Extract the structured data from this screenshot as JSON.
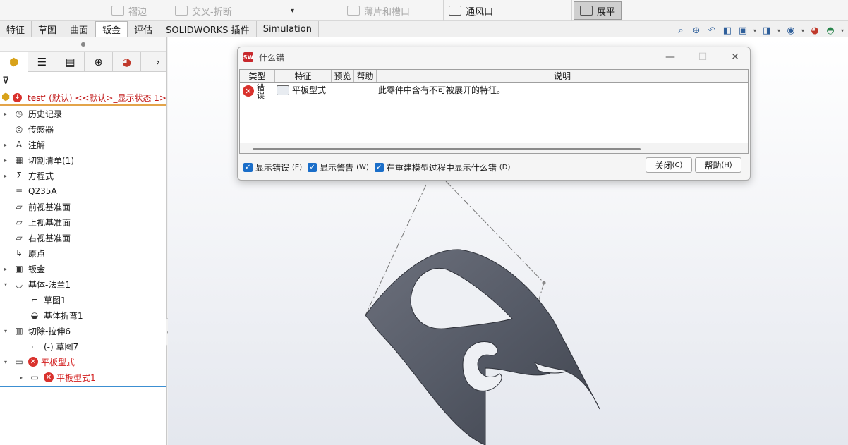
{
  "ribbon": {
    "items": [
      {
        "label": "褶边",
        "disabled": true
      },
      {
        "label": "交叉-折断",
        "disabled": true
      },
      {
        "label": "薄片和槽口",
        "disabled": true
      },
      {
        "label": "通风口",
        "disabled": false
      },
      {
        "label": "展平",
        "disabled": false,
        "active": true
      }
    ]
  },
  "tabs": [
    "特征",
    "草图",
    "曲面",
    "钣金",
    "评估",
    "SOLIDWORKS 插件",
    "Simulation"
  ],
  "active_tab": "钣金",
  "view_tools": [
    "zoom-to-fit-icon",
    "zoom-to-area-icon",
    "previous-view-icon",
    "section-view-icon",
    "view-orientation-icon",
    "display-style-icon",
    "hide-show-icon",
    "appearance-icon",
    "scene-icon"
  ],
  "panel": {
    "tabs": [
      "featuremanager-icon",
      "propertymanager-icon",
      "configurationmanager-icon",
      "dimxpert-icon",
      "display-manager-icon"
    ],
    "root": "test' (默认) <<默认>_显示状态 1>",
    "tree": [
      {
        "label": "历史记录",
        "expand": true,
        "indent": 0,
        "icon": "history-icon"
      },
      {
        "label": "传感器",
        "expand": false,
        "indent": 0,
        "icon": "sensor-icon"
      },
      {
        "label": "注解",
        "expand": true,
        "indent": 0,
        "icon": "annotation-icon"
      },
      {
        "label": "切割清单(1)",
        "expand": true,
        "indent": 0,
        "icon": "cut-list-icon"
      },
      {
        "label": "方程式",
        "expand": true,
        "indent": 0,
        "icon": "equation-icon"
      },
      {
        "label": "Q235A",
        "expand": false,
        "indent": 0,
        "icon": "material-icon"
      },
      {
        "label": "前视基准面",
        "expand": false,
        "indent": 0,
        "icon": "plane-icon"
      },
      {
        "label": "上视基准面",
        "expand": false,
        "indent": 0,
        "icon": "plane-icon"
      },
      {
        "label": "右视基准面",
        "expand": false,
        "indent": 0,
        "icon": "plane-icon"
      },
      {
        "label": "原点",
        "expand": false,
        "indent": 0,
        "icon": "origin-icon"
      },
      {
        "label": "钣金",
        "expand": true,
        "indent": 0,
        "icon": "sheet-metal-icon"
      },
      {
        "label": "基体-法兰1",
        "expand": true,
        "open": true,
        "indent": 0,
        "icon": "base-flange-icon"
      },
      {
        "label": "草图1",
        "expand": false,
        "indent": 1,
        "icon": "sketch-icon"
      },
      {
        "label": "基体折弯1",
        "expand": false,
        "indent": 1,
        "icon": "bend-icon"
      },
      {
        "label": "切除-拉伸6",
        "expand": true,
        "open": true,
        "indent": 0,
        "icon": "extruded-cut-icon"
      },
      {
        "label": "(-) 草图7",
        "expand": false,
        "indent": 1,
        "icon": "sketch-icon"
      },
      {
        "label": "平板型式",
        "expand": true,
        "open": true,
        "indent": 0,
        "icon": "flat-pattern-icon",
        "error": true
      },
      {
        "label": "平板型式1",
        "expand": true,
        "indent": 1,
        "icon": "flat-pattern-icon",
        "error": true
      }
    ]
  },
  "dialog": {
    "title": "什么错",
    "columns": {
      "type": "类型",
      "feature": "特征",
      "preview": "预览",
      "help": "帮助",
      "description": "说明"
    },
    "rows": [
      {
        "type": "错误",
        "feature": "平板型式",
        "description": "此零件中含有不可被展开的特征。"
      }
    ],
    "options": [
      {
        "label": "显示错误",
        "accel": "(E)",
        "checked": true
      },
      {
        "label": "显示警告",
        "accel": "(W)",
        "checked": true
      },
      {
        "label": "在重建模型过程中显示什么错",
        "accel": "(D)",
        "checked": true
      }
    ],
    "buttons": {
      "close": "关闭",
      "close_accel": "(C)",
      "help": "帮助",
      "help_accel": "(H)"
    }
  },
  "colors": {
    "error": "#d9322d",
    "accent": "#1a6ec9",
    "part": "#5b5f6b"
  }
}
